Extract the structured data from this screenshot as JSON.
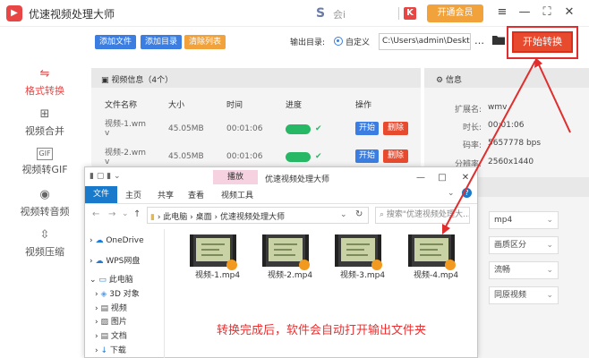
{
  "app": {
    "logo": "▶",
    "title": "优速视频处理大师",
    "user_logo": "S",
    "user_name": "会i",
    "k_icon": "K",
    "vip_label": "开通会员"
  },
  "window": {
    "menu": "≡",
    "minimize": "—",
    "maximize": "⛶",
    "close": "✕"
  },
  "nav": [
    {
      "icon": "⇋",
      "label": "格式转换"
    },
    {
      "icon": "⊞",
      "label": "视频合并"
    },
    {
      "icon": "GIF",
      "label": "视频转GIF"
    },
    {
      "icon": "◉",
      "label": "视频转音频"
    },
    {
      "icon": "⇳",
      "label": "视频压缩"
    }
  ],
  "toolbar": {
    "add_file": "添加文件",
    "add_dir": "添加目录",
    "clear_list": "清除列表",
    "output_label": "输出目录:",
    "radio_label": "自定义",
    "path": "C:\\Users\\admin\\Deskto",
    "more": "…",
    "start": "开始转换"
  },
  "video_panel": {
    "title": "视频信息（4个）",
    "columns": [
      "文件名称",
      "大小",
      "时间",
      "进度",
      "操作"
    ],
    "rows": [
      {
        "name1": "视频-1.wm",
        "name2": "v",
        "size": "45.05MB",
        "time": "00:01:06",
        "progress": 1.0,
        "check": "✔",
        "open": "开始",
        "del": "删除"
      },
      {
        "name1": "视频-2.wm",
        "name2": "v",
        "size": "45.05MB",
        "time": "00:01:06",
        "progress": 1.0,
        "check": "✔",
        "open": "开始",
        "del": "删除"
      }
    ]
  },
  "info_panel": {
    "title": "信息",
    "fields": [
      {
        "key": "扩展名:",
        "value": "wmv"
      },
      {
        "key": "时长:",
        "value": "00:01:06"
      },
      {
        "key": "码率:",
        "value": "5657778 bps"
      },
      {
        "key": "分辨率:",
        "value": "2560x1440"
      }
    ],
    "selects": [
      "mp4",
      "画质区分",
      "流畅",
      "同原视频"
    ]
  },
  "explorer": {
    "title": "优速视频处理大师",
    "tool_tab": "播放",
    "tabs": [
      "文件",
      "主页",
      "共享",
      "查看",
      "视频工具"
    ],
    "nav_back": "←",
    "nav_forward": "→",
    "nav_up": "↑",
    "path": [
      "此电脑",
      "桌面",
      "优速视频处理大师"
    ],
    "refresh": "↻",
    "search_placeholder": "搜索\"优速视频处理大...",
    "tree": [
      "OneDrive",
      "WPS网盘",
      "此电脑",
      "3D 对象",
      "视频",
      "图片",
      "文档",
      "下载"
    ],
    "files": [
      "视频-1.mp4",
      "视频-2.mp4",
      "视频-3.mp4",
      "视频-4.mp4"
    ],
    "help": "?",
    "expand": "⌄"
  },
  "caption": "转换完成后，软件会自动打开输出文件夹",
  "colors": {
    "accent": "#e84545",
    "blue": "#3b7de0",
    "orange": "#f2a23a",
    "green": "#27b865"
  }
}
